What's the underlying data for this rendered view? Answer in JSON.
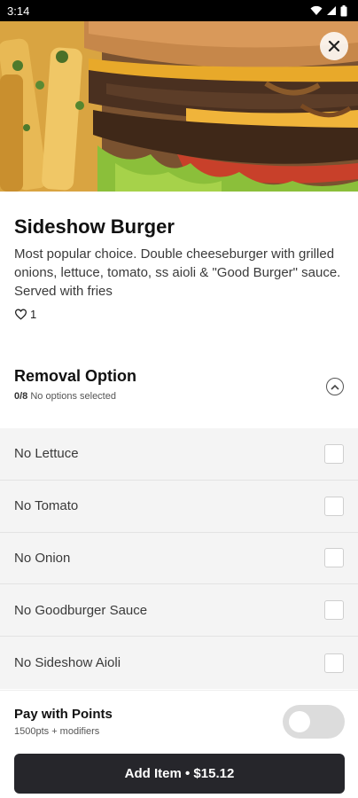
{
  "status_bar": {
    "time": "3:14"
  },
  "colors": {
    "primary_button": "#26262b",
    "toggle_off": "#dcdcdc",
    "options_bg": "#f4f4f4"
  },
  "hero": {
    "image_name": "burger-photo",
    "close_icon": "close-icon"
  },
  "item": {
    "title": "Sideshow Burger",
    "description": "Most popular choice. Double cheeseburger with grilled onions, lettuce, tomato, ss aioli & \"Good Burger\" sauce. Served with fries",
    "likes_count": "1",
    "like_icon": "heart-outline-icon"
  },
  "modifier_group": {
    "title": "Removal Option",
    "count": "0/8",
    "status": "No options selected",
    "collapse_icon": "chevron-up-icon",
    "options": [
      {
        "label": "No Lettuce",
        "checked": false
      },
      {
        "label": "No Tomato",
        "checked": false
      },
      {
        "label": "No Onion",
        "checked": false
      },
      {
        "label": "No Goodburger Sauce",
        "checked": false
      },
      {
        "label": "No Sideshow Aioli",
        "checked": false
      }
    ]
  },
  "footer": {
    "pay_title": "Pay with Points",
    "pay_subtitle": "1500pts + modifiers",
    "pay_toggle_on": false,
    "add_button_label": "Add Item • $15.12"
  }
}
